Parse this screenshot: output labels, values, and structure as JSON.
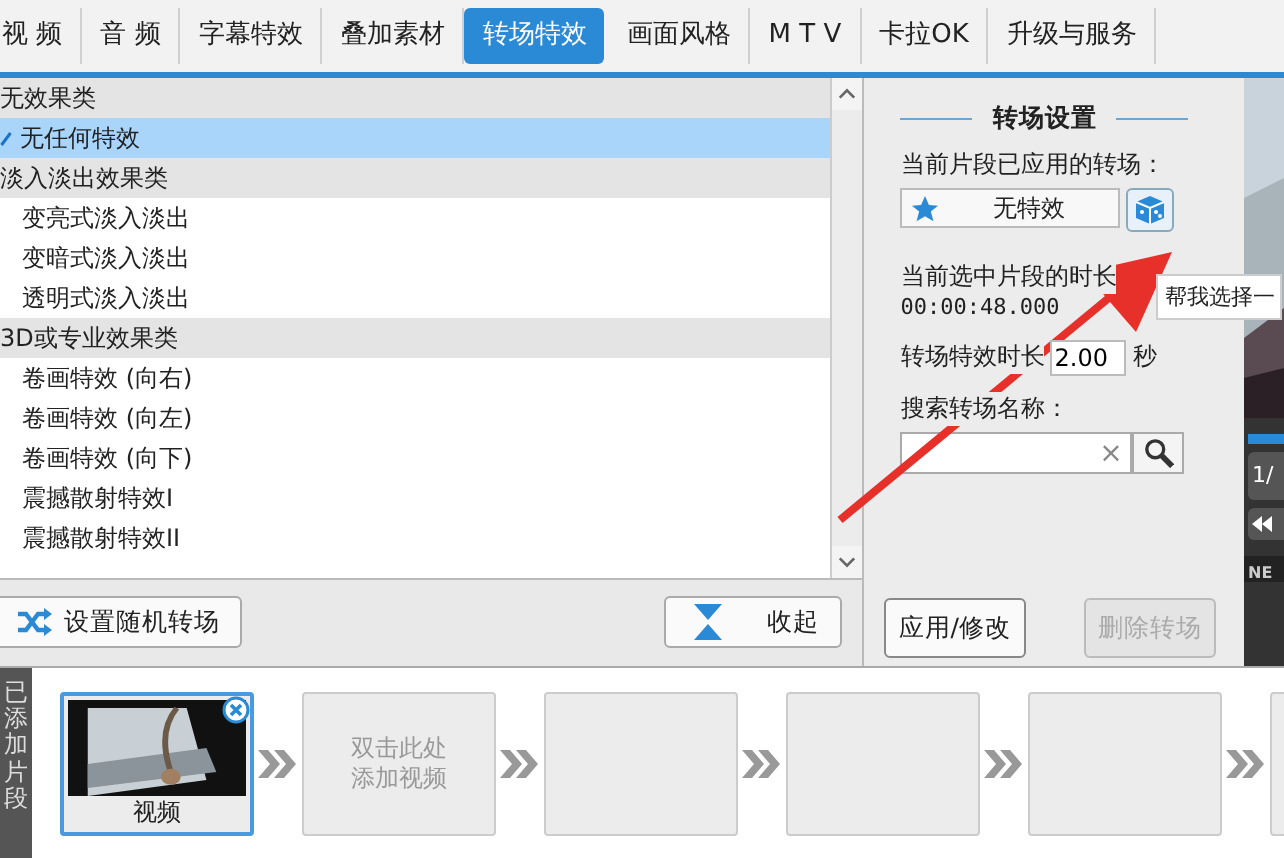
{
  "tabs": [
    {
      "label": "视 频",
      "selected": false
    },
    {
      "label": "音 频",
      "selected": false
    },
    {
      "label": "字幕特效",
      "selected": false
    },
    {
      "label": "叠加素材",
      "selected": false
    },
    {
      "label": "转场特效",
      "selected": true
    },
    {
      "label": "画面风格",
      "selected": false
    },
    {
      "label": "M T V",
      "selected": false
    },
    {
      "label": "卡拉OK",
      "selected": false
    },
    {
      "label": "升级与服务",
      "selected": false
    }
  ],
  "effect_list": {
    "groups": [
      {
        "label": "无效果类",
        "children": [
          {
            "label": "无任何特效",
            "selected": true
          }
        ]
      },
      {
        "label": "淡入淡出效果类",
        "children": [
          {
            "label": "变亮式淡入淡出",
            "selected": false
          },
          {
            "label": "变暗式淡入淡出",
            "selected": false
          },
          {
            "label": "透明式淡入淡出",
            "selected": false
          }
        ]
      },
      {
        "label": "3D或专业效果类",
        "children": [
          {
            "label": "卷画特效 (向右)",
            "selected": false
          },
          {
            "label": "卷画特效 (向左)",
            "selected": false
          },
          {
            "label": "卷画特效 (向下)",
            "selected": false
          },
          {
            "label": "震撼散射特效I",
            "selected": false
          },
          {
            "label": "震撼散射特效II",
            "selected": false
          }
        ]
      }
    ]
  },
  "list_buttons": {
    "random": "设置随机转场",
    "collapse": "收起"
  },
  "settings": {
    "title": "转场设置",
    "applied_label": "当前片段已应用的转场：",
    "applied_value": "无特效",
    "tooltip": "帮我选择一",
    "clip_duration_label": "当前选中片段的时长",
    "clip_duration": "00:00:48.000",
    "effect_duration_label": "转场特效时长",
    "effect_duration": "2.00",
    "effect_duration_unit": "秒",
    "search_label": "搜索转场名称：",
    "clear": "×",
    "apply": {
      "label": "应用/修改",
      "disabled": false
    },
    "delete": {
      "label": "删除转场",
      "disabled": true
    }
  },
  "preview": {
    "page": "1/",
    "logo": "NE"
  },
  "timeline": {
    "label": "已添加片段",
    "clips": [
      {
        "kind": "video",
        "label": "视频",
        "selected": true
      },
      {
        "kind": "empty",
        "hint": "双击此处添加视频",
        "selected": false
      },
      {
        "kind": "empty",
        "selected": false
      },
      {
        "kind": "empty",
        "selected": false
      },
      {
        "kind": "empty",
        "selected": false
      },
      {
        "kind": "empty",
        "selected": false
      }
    ]
  }
}
